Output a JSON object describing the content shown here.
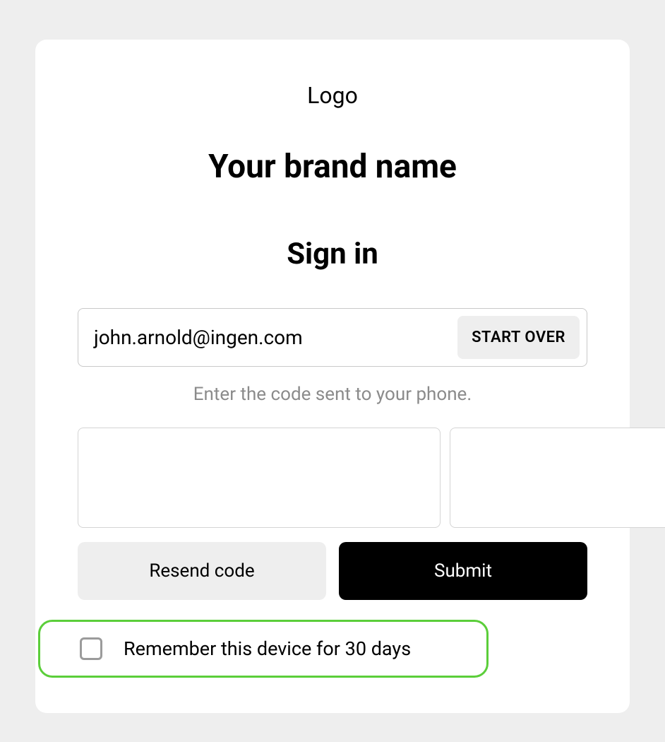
{
  "card": {
    "logo_text": "Logo",
    "brand_name": "Your brand name",
    "signin_title": "Sign in",
    "email_value": "john.arnold@ingen.com",
    "start_over_label": "START OVER",
    "instruction_text": "Enter the code sent to your phone.",
    "code_digits": [
      "",
      "",
      "",
      "",
      "",
      ""
    ],
    "resend_label": "Resend code",
    "submit_label": "Submit",
    "remember_label": "Remember this device for 30 days",
    "remember_checked": false
  },
  "colors": {
    "highlight_border": "#5bce3a",
    "page_bg": "#eeeeee",
    "card_bg": "#ffffff",
    "button_dark": "#000000",
    "button_light": "#eeeeee"
  }
}
